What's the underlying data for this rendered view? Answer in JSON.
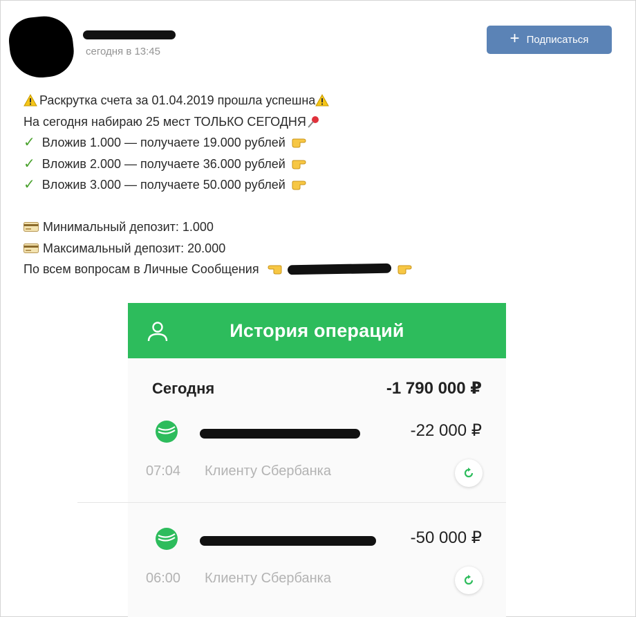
{
  "header": {
    "post_time": "сегодня в 13:45",
    "subscribe_label": "Подписаться"
  },
  "post": {
    "line1": "Раскрутка счета за 01.04.2019 прошла успешна",
    "line2": "На сегодня набираю 25 мест ТОЛЬКО СЕГОДНЯ",
    "offers": [
      "Вложив 1.000 — получаете 19.000 рублей",
      "Вложив 2.000 — получаете 36.000 рублей",
      "Вложив 3.000 — получаете 50.000 рублей"
    ],
    "min_deposit": "Минимальный депозит: 1.000",
    "max_deposit": "Максимальный депозит: 20.000",
    "contact": "По всем вопросам в Личные Сообщения"
  },
  "bank_screenshot": {
    "title": "История операций",
    "day_label": "Сегодня",
    "day_total": "-1 790 000 ₽",
    "transactions": [
      {
        "amount": "-22 000 ₽",
        "time": "07:04",
        "description": "Клиенту Сбербанка"
      },
      {
        "amount": "-50 000 ₽",
        "time": "06:00",
        "description": "Клиенту Сбербанка"
      }
    ]
  },
  "icons": {
    "warning": "warning-icon",
    "pushpin": "pushpin-icon",
    "check": "check-mark-icon",
    "hand": "pointing-hand-icon",
    "card": "credit-card-icon",
    "user": "user-icon",
    "sber": "sberbank-logo-icon",
    "repeat": "repeat-icon"
  },
  "colors": {
    "subscribe_button": "#5b83b6",
    "bank_header": "#2dbc5c",
    "check": "#4aa22e"
  }
}
